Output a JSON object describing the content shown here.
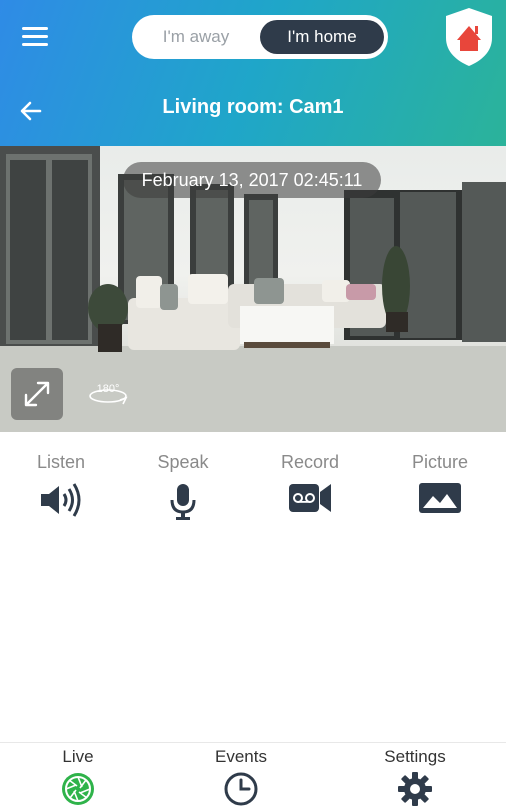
{
  "header": {
    "mode_toggle": {
      "away_label": "I'm away",
      "home_label": "I'm home",
      "selected": "I'm home"
    },
    "title": "Living room: Cam1"
  },
  "camera": {
    "timestamp": "February 13, 2017 02:45:11",
    "rotate_label": "180°"
  },
  "controls": [
    {
      "label": "Listen",
      "icon": "speaker-icon"
    },
    {
      "label": "Speak",
      "icon": "microphone-icon"
    },
    {
      "label": "Record",
      "icon": "record-icon"
    },
    {
      "label": "Picture",
      "icon": "picture-icon"
    }
  ],
  "bottom_nav": [
    {
      "label": "Live",
      "icon": "live-icon",
      "active": true
    },
    {
      "label": "Events",
      "icon": "clock-icon",
      "active": false
    },
    {
      "label": "Settings",
      "icon": "gear-icon",
      "active": false
    }
  ],
  "colors": {
    "accent_green": "#2fb34a",
    "dark_control": "#2f3b4a"
  }
}
